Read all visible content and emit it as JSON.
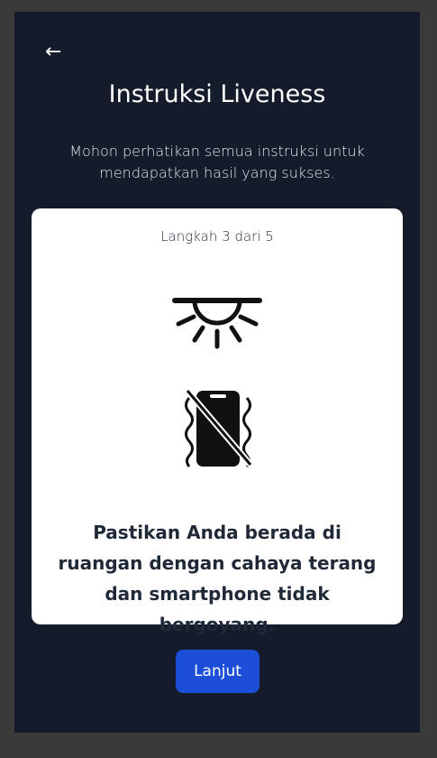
{
  "header": {
    "back_icon": "←",
    "title": "Instruksi Liveness",
    "subtitle": "Mohon perhatikan semua instruksi untuk mendapatkan hasil yang sukses."
  },
  "card": {
    "step_label": "Langkah 3  dari 5",
    "icons": [
      "light-icon",
      "no-shaking-phone-icon"
    ],
    "instruction": "Pastikan Anda berada di ruangan dengan cahaya terang dan smartphone tidak bergoyang."
  },
  "actions": {
    "next_label": "Lanjut"
  },
  "colors": {
    "background": "#141b2b",
    "card": "#ffffff",
    "primary": "#1d4ed8"
  }
}
